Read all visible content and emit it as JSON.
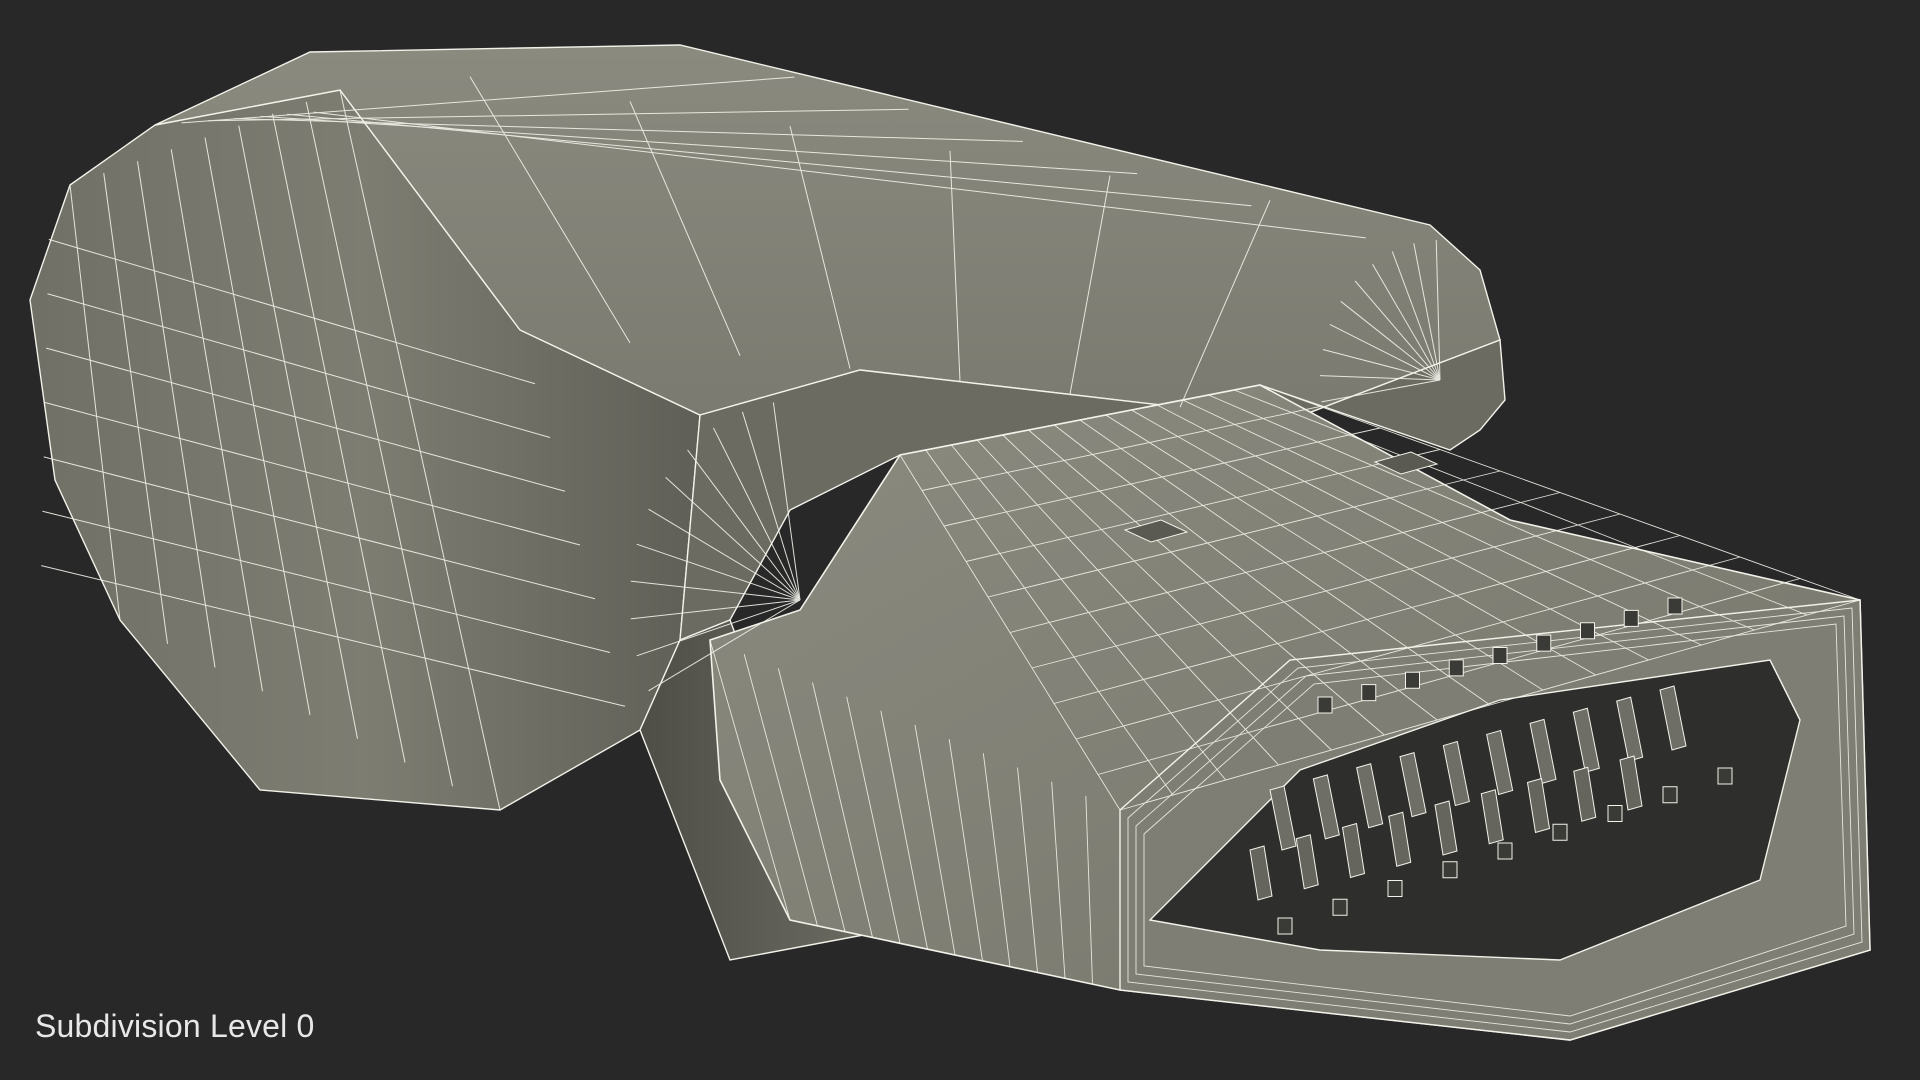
{
  "viewport": {
    "caption": "Subdivision Level 0",
    "background_color": "#282828",
    "model_subject": "connector plug wireframe render",
    "colors": {
      "mesh_fill_light": "#8a8a7f",
      "mesh_fill_mid": "#77776c",
      "mesh_fill_dark": "#55554d",
      "wire": "#f2f2ea",
      "cavity": "#2e2e2c"
    }
  }
}
